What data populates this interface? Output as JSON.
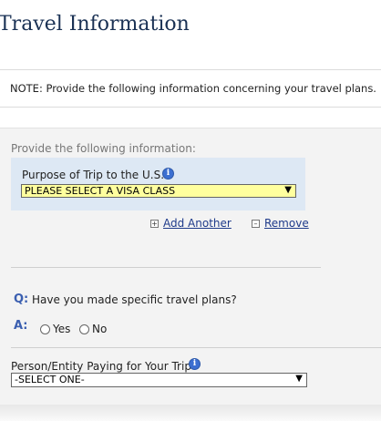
{
  "page": {
    "title": "Travel Information",
    "note": "NOTE: Provide the following information concerning your travel plans."
  },
  "form": {
    "provide_label": "Provide the following information:",
    "purpose": {
      "label": "Purpose of Trip to the U.S.",
      "selected": "PLEASE SELECT A VISA CLASS"
    },
    "add_another": "Add Another",
    "remove": "Remove",
    "question": {
      "q_marker": "Q:",
      "text": "Have you made specific travel plans?",
      "a_marker": "A:",
      "options": [
        "Yes",
        "No"
      ]
    },
    "payer": {
      "label": "Person/Entity Paying for Your Trip",
      "selected": "-SELECT ONE-"
    }
  },
  "colors": {
    "title": "#1a3154",
    "purpose_box": "#dde8f4",
    "visa_select": "#ffff9e",
    "link": "#1e3a8a",
    "qa_marker": "#3b5fb0"
  },
  "icons": [
    "info-icon",
    "plus-icon",
    "minus-icon",
    "chevron-down-icon"
  ]
}
